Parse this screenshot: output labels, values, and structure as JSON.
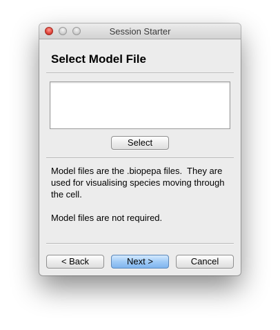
{
  "window": {
    "title": "Session Starter"
  },
  "page": {
    "heading": "Select Model File",
    "select_button": "Select",
    "info_lines": [
      "Model files are the .biopepa files.  They are used for visualising species moving through the cell.",
      "Model files are not required."
    ]
  },
  "footer": {
    "back_label": "< Back",
    "next_label": "Next >",
    "cancel_label": "Cancel"
  }
}
